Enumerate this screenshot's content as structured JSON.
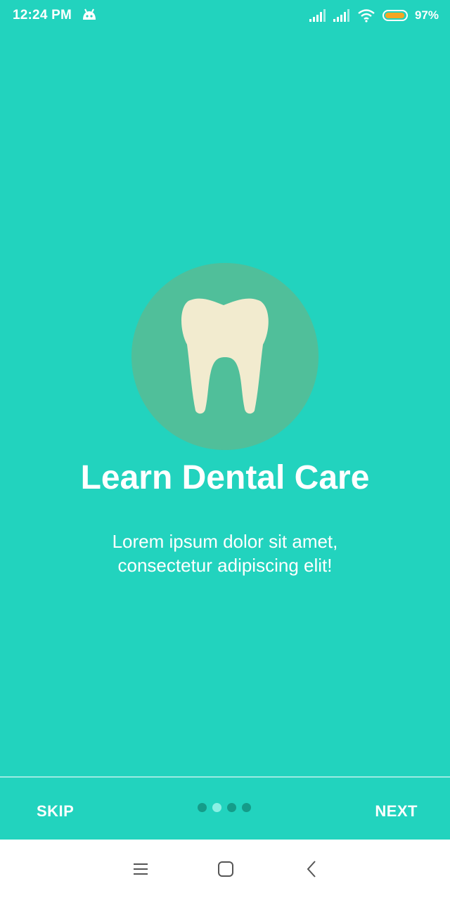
{
  "status_bar": {
    "time": "12:24 PM",
    "battery_percent": "97%",
    "battery_level": 0.97,
    "icons": [
      "android-icon",
      "signal-icon",
      "signal-icon",
      "wifi-icon",
      "battery-icon"
    ]
  },
  "onboarding": {
    "illustration": "tooth-icon",
    "title": "Learn Dental Care",
    "description": "Lorem ipsum dolor sit amet, consectetur adipiscing elit!",
    "skip_label": "SKIP",
    "next_label": "NEXT",
    "page_count": 4,
    "current_page": 2
  },
  "nav_bar": {
    "icons": [
      "menu-icon",
      "home-icon",
      "back-icon"
    ]
  },
  "colors": {
    "background": "#22D3BE",
    "circle": "#50BF9A",
    "tooth": "#F2EBCF",
    "dot_inactive": "#149C89",
    "dot_active": "#8AF0E4",
    "battery": "#F5A623"
  }
}
